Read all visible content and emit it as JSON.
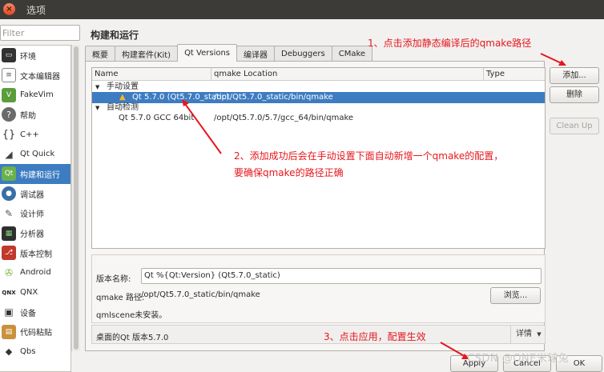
{
  "window": {
    "title": "选项"
  },
  "filter": {
    "placeholder": "Filter"
  },
  "sidebar": {
    "items": [
      {
        "label": "环境",
        "icon": "monitor-icon"
      },
      {
        "label": "文本编辑器",
        "icon": "text-editor-icon"
      },
      {
        "label": "FakeVim",
        "icon": "fakevim-icon"
      },
      {
        "label": "帮助",
        "icon": "help-icon"
      },
      {
        "label": "C++",
        "icon": "cpp-braces-icon"
      },
      {
        "label": "Qt Quick",
        "icon": "qt-quick-icon"
      },
      {
        "label": "构建和运行",
        "icon": "build-run-icon",
        "active": true
      },
      {
        "label": "调试器",
        "icon": "debugger-icon"
      },
      {
        "label": "设计师",
        "icon": "designer-icon"
      },
      {
        "label": "分析器",
        "icon": "analyzer-icon"
      },
      {
        "label": "版本控制",
        "icon": "version-control-icon"
      },
      {
        "label": "Android",
        "icon": "android-icon"
      },
      {
        "label": "QNX",
        "icon": "qnx-icon"
      },
      {
        "label": "设备",
        "icon": "devices-icon"
      },
      {
        "label": "代码粘贴",
        "icon": "code-paste-icon"
      },
      {
        "label": "Qbs",
        "icon": "qbs-icon"
      }
    ]
  },
  "page": {
    "heading": "构建和运行"
  },
  "tabs": [
    {
      "label": "概要"
    },
    {
      "label": "构建套件(Kit)"
    },
    {
      "label": "Qt Versions",
      "active": true
    },
    {
      "label": "编译器"
    },
    {
      "label": "Debuggers"
    },
    {
      "label": "CMake"
    }
  ],
  "tree": {
    "columns": [
      "Name",
      "qmake Location",
      "Type"
    ],
    "groups": [
      {
        "label": "手动设置",
        "rows": [
          {
            "name": "Qt 5.7.0 (Qt5.7.0_static)",
            "location": "/opt/Qt5.7.0_static/bin/qmake",
            "selected": true
          }
        ]
      },
      {
        "label": "自动检测",
        "rows": [
          {
            "name": "Qt 5.7.0 GCC 64bit",
            "location": "/opt/Qt5.7.0/5.7/gcc_64/bin/qmake",
            "selected": false
          }
        ]
      }
    ]
  },
  "buttons": {
    "add": "添加...",
    "remove": "删除",
    "cleanup": "Clean Up",
    "browse": "浏览...",
    "details": "详情",
    "apply": "Apply",
    "cancel": "Cancel",
    "ok": "OK"
  },
  "details": {
    "version_name_label": "版本名称:",
    "version_name_value": "Qt %{Qt:Version} (Qt5.7.0_static)",
    "qmake_path_label": "qmake 路径:",
    "qmake_path_value": "/opt/Qt5.7.0_static/bin/qmake",
    "qmlscene_status": "qmlscene未安装。"
  },
  "desktop_status": "桌面的Qt 版本5.7.0",
  "annotations": {
    "step1": "1、点击添加静态编译后的qmake路径",
    "step2_line1": "2、添加成功后会在手动设置下面自动新增一个qmake的配置，",
    "step2_line2": "要确保qmake的路径正确",
    "step3": "3、点击应用，配置生效"
  },
  "watermark": "CSDN @ONE米球兔",
  "colors": {
    "selection": "#3d7cc1",
    "annotation": "#e6161d",
    "titlebar": "#3c3b37"
  }
}
